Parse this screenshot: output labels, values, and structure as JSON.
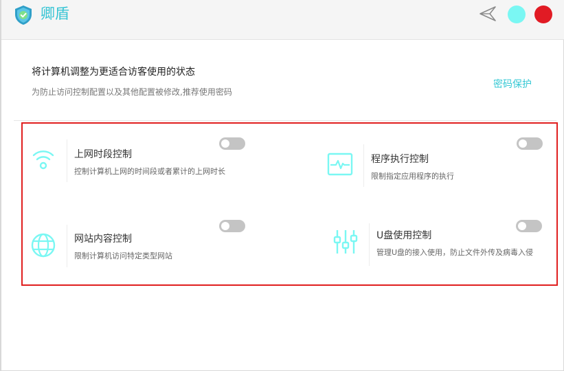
{
  "app": {
    "title": "卿盾",
    "accent_color": "#35c4d4",
    "logo_icon": "shield-check-icon"
  },
  "window_controls": {
    "send_icon": "send-arrow-icon",
    "minimize_color": "#7af7f3",
    "close_color": "#e11b24"
  },
  "header": {
    "title": "将计算机调整为更适合访客使用的状态",
    "description": "为防止访问控制配置以及其他配置被修改,推荐使用密码",
    "password_link": "密码保护"
  },
  "features": [
    {
      "id": "internet-time",
      "icon": "wifi-icon",
      "title": "上网时段控制",
      "description": "控制计算机上网的时间段或者累计的上网时长",
      "enabled": false
    },
    {
      "id": "program-exec",
      "icon": "monitor-pulse-icon",
      "title": "程序执行控制",
      "description": "限制指定应用程序的执行",
      "enabled": false
    },
    {
      "id": "website-content",
      "icon": "globe-icon",
      "title": "网站内容控制",
      "description": "限制计算机访问特定类型网站",
      "enabled": false
    },
    {
      "id": "usb-control",
      "icon": "sliders-icon",
      "title": "U盘使用控制",
      "description": "管理U盘的接入使用，防止文件外传及病毒入侵",
      "enabled": false
    }
  ]
}
